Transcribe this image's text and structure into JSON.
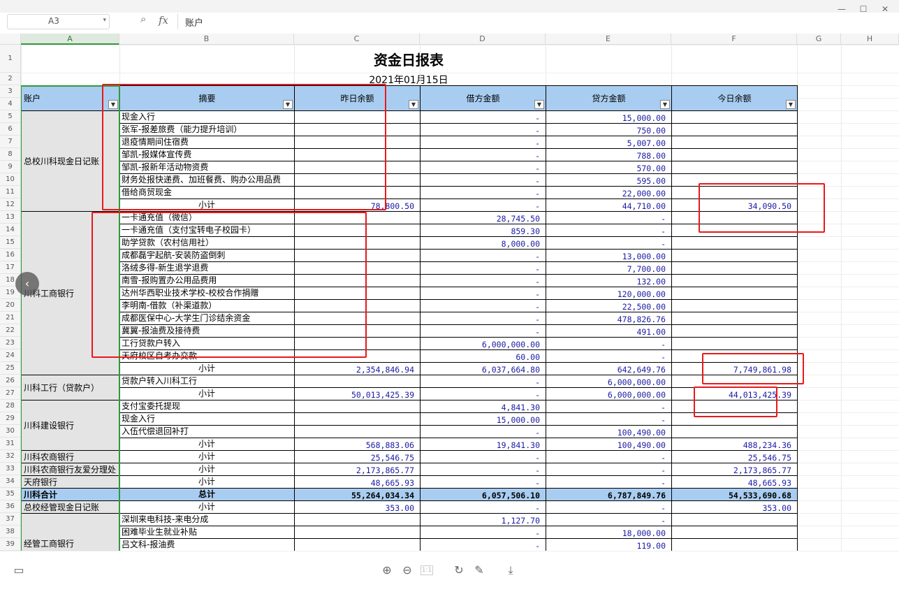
{
  "window": {
    "minimize_icon": "—",
    "maximize_icon": "☐",
    "close_icon": "✕"
  },
  "formula": {
    "cell_ref": "A3",
    "fx": "fx",
    "value": "账户"
  },
  "columns": [
    "A",
    "B",
    "C",
    "D",
    "E",
    "F",
    "G",
    "H"
  ],
  "rows": [
    "1",
    "2",
    "3",
    "4",
    "5",
    "6",
    "7",
    "8",
    "9",
    "10",
    "11",
    "12",
    "13",
    "14",
    "15",
    "16",
    "17",
    "18",
    "19",
    "20",
    "21",
    "22",
    "23",
    "24",
    "25",
    "26",
    "27",
    "28",
    "29",
    "30",
    "31",
    "32",
    "33",
    "34",
    "35",
    "36",
    "37",
    "38",
    "39"
  ],
  "sheet": {
    "title": "资金日报表",
    "date": "2021年01月15日",
    "headers": {
      "account": "账户",
      "summary": "摘要",
      "prev_balance": "昨日余额",
      "debit": "借方金额",
      "credit": "贷方金额",
      "today_balance": "今日余额"
    },
    "accounts": {
      "a1": "总校川科现金日记账",
      "a2": "川科工商银行",
      "a3": "川科工行（贷款户）",
      "a4": "川科建设银行",
      "a5": "川科农商银行",
      "a6": "川科农商银行友爱分理处",
      "a7": "天府银行",
      "a8": "川科合计",
      "a9": "总校经管现金日记账",
      "a10": "经管工商银行"
    },
    "lines": [
      {
        "s": "现金入行",
        "c": "",
        "d": "-",
        "e": "15,000.00",
        "f": ""
      },
      {
        "s": "张军-报差旅费（能力提升培训）",
        "c": "",
        "d": "-",
        "e": "750.00",
        "f": ""
      },
      {
        "s": "退疫情期间住宿费",
        "c": "",
        "d": "-",
        "e": "5,007.00",
        "f": ""
      },
      {
        "s": "邹凯-报媒体宣传费",
        "c": "",
        "d": "-",
        "e": "788.00",
        "f": ""
      },
      {
        "s": "邹凯-报新年活动物资费",
        "c": "",
        "d": "-",
        "e": "570.00",
        "f": ""
      },
      {
        "s": "财务处报快递费、加班餐费、购办公用品费",
        "c": "",
        "d": "-",
        "e": "595.00",
        "f": ""
      },
      {
        "s": "借给商贸现金",
        "c": "",
        "d": "-",
        "e": "22,000.00",
        "f": ""
      },
      {
        "s": "小计",
        "c": "78,800.50",
        "d": "-",
        "e": "44,710.00",
        "f": "34,090.50"
      },
      {
        "s": "一卡通充值（微信）",
        "c": "",
        "d": "28,745.50",
        "e": "-",
        "f": ""
      },
      {
        "s": "一卡通充值（支付宝转电子校园卡）",
        "c": "",
        "d": "859.30",
        "e": "-",
        "f": ""
      },
      {
        "s": "助学贷款（农村信用社）",
        "c": "",
        "d": "8,000.00",
        "e": "-",
        "f": ""
      },
      {
        "s": "成都磊宇起航-安装防盗倒刺",
        "c": "",
        "d": "-",
        "e": "13,000.00",
        "f": ""
      },
      {
        "s": "洛绒多得-新生退学退费",
        "c": "",
        "d": "-",
        "e": "7,700.00",
        "f": ""
      },
      {
        "s": "南雪-报购置办公用品费用",
        "c": "",
        "d": "-",
        "e": "132.00",
        "f": ""
      },
      {
        "s": "达州华西职业技术学校-校校合作捐赠",
        "c": "",
        "d": "-",
        "e": "120,000.00",
        "f": ""
      },
      {
        "s": "李明南-借款（补渠道款）",
        "c": "",
        "d": "-",
        "e": "22,500.00",
        "f": ""
      },
      {
        "s": "成都医保中心-大学生门诊结余资金",
        "c": "",
        "d": "-",
        "e": "478,826.76",
        "f": ""
      },
      {
        "s": "冀翼-报油费及接待费",
        "c": "",
        "d": "-",
        "e": "491.00",
        "f": ""
      },
      {
        "s": "工行贷款户转入",
        "c": "",
        "d": "6,000,000.00",
        "e": "-",
        "f": ""
      },
      {
        "s": "天府校区自考办交款",
        "c": "",
        "d": "60.00",
        "e": "-",
        "f": ""
      },
      {
        "s": "小计",
        "c": "2,354,846.94",
        "d": "6,037,664.80",
        "e": "642,649.76",
        "f": "7,749,861.98"
      },
      {
        "s": "贷款户转入川科工行",
        "c": "",
        "d": "-",
        "e": "6,000,000.00",
        "f": ""
      },
      {
        "s": "小计",
        "c": "50,013,425.39",
        "d": "-",
        "e": "6,000,000.00",
        "f": "44,013,425.39"
      },
      {
        "s": "支付宝委托提现",
        "c": "",
        "d": "4,841.30",
        "e": "-",
        "f": ""
      },
      {
        "s": "现金入行",
        "c": "",
        "d": "15,000.00",
        "e": "-",
        "f": ""
      },
      {
        "s": "入伍代偿退回补打",
        "c": "",
        "d": "-",
        "e": "100,490.00",
        "f": ""
      },
      {
        "s": "小计",
        "c": "568,883.06",
        "d": "19,841.30",
        "e": "100,490.00",
        "f": "488,234.36"
      },
      {
        "s": "小计",
        "c": "25,546.75",
        "d": "-",
        "e": "-",
        "f": "25,546.75"
      },
      {
        "s": "小计",
        "c": "2,173,865.77",
        "d": "-",
        "e": "-",
        "f": "2,173,865.77"
      },
      {
        "s": "小计",
        "c": "48,665.93",
        "d": "-",
        "e": "-",
        "f": "48,665.93"
      },
      {
        "s": "总计",
        "c": "55,264,034.34",
        "d": "6,057,506.10",
        "e": "6,787,849.76",
        "f": "54,533,690.68"
      },
      {
        "s": "小计",
        "c": "353.00",
        "d": "-",
        "e": "-",
        "f": "353.00"
      },
      {
        "s": "深圳来电科技-来电分成",
        "c": "",
        "d": "1,127.70",
        "e": "-",
        "f": ""
      },
      {
        "s": "困难毕业生就业补贴",
        "c": "",
        "d": "-",
        "e": "18,000.00",
        "f": ""
      },
      {
        "s": "吕文科-报油费",
        "c": "",
        "d": "-",
        "e": "119.00",
        "f": ""
      }
    ]
  },
  "toolbar": {
    "panel_icon": "▭",
    "zoom_in_icon": "⊕",
    "zoom_out_icon": "⊖",
    "fit_icon": "1:1",
    "rotate_icon": "↻",
    "edit_icon": "✎",
    "download_icon": "⤓"
  },
  "nav": {
    "prev_icon": "‹"
  }
}
